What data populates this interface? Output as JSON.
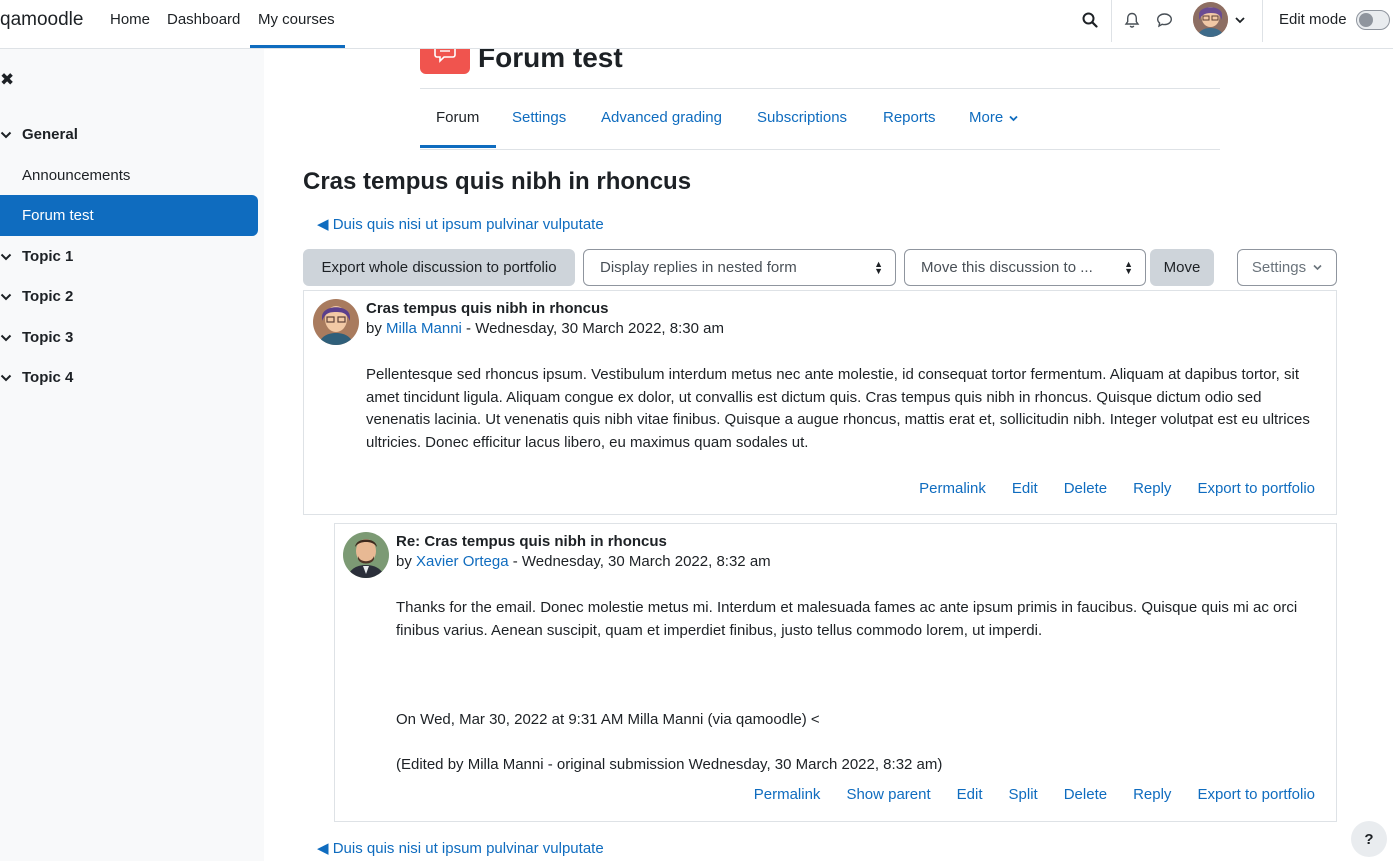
{
  "navbar": {
    "brand": "qamoodle",
    "links": [
      "Home",
      "Dashboard",
      "My courses"
    ],
    "active_link": "My courses",
    "edit_mode_label": "Edit mode",
    "edit_mode_on": false
  },
  "drawer": {
    "sections": [
      {
        "label": "General",
        "items": [
          "Announcements",
          "Forum test"
        ]
      },
      {
        "label": "Topic 1"
      },
      {
        "label": "Topic 2"
      },
      {
        "label": "Topic 3"
      },
      {
        "label": "Topic 4"
      }
    ],
    "active_item": "Forum test"
  },
  "forum": {
    "title": "Forum test",
    "tabs": [
      "Forum",
      "Settings",
      "Advanced grading",
      "Subscriptions",
      "Reports",
      "More"
    ],
    "active_tab": "Forum"
  },
  "discussion": {
    "title": "Cras tempus quis nibh in rhoncus",
    "prev_link": "◀ Duis quis nisi ut ipsum pulvinar vulputate",
    "export_button": "Export whole discussion to portfolio",
    "display_select": "Display replies in nested form",
    "move_select": "Move this discussion to ...",
    "move_button": "Move",
    "settings_button": "Settings"
  },
  "posts": [
    {
      "subject": "Cras tempus quis nibh in rhoncus",
      "by": "by",
      "author": "Milla Manni",
      "date": " - Wednesday, 30 March 2022, 8:30 am",
      "body": "Pellentesque sed rhoncus ipsum. Vestibulum interdum metus nec ante molestie, id consequat tortor fermentum. Aliquam at dapibus tortor, sit amet tincidunt ligula. Aliquam congue ex dolor, ut convallis est dictum quis. Cras tempus quis nibh in rhoncus. Quisque dictum odio sed venenatis lacinia. Ut venenatis quis nibh vitae finibus. Quisque a augue rhoncus, mattis erat et, sollicitudin nibh. Integer volutpat est eu ultrices ultricies. Donec efficitur lacus libero, eu maximus quam sodales ut.",
      "actions": [
        "Permalink",
        "Edit",
        "Delete",
        "Reply",
        "Export to portfolio"
      ]
    },
    {
      "subject": "Re: Cras tempus quis nibh in rhoncus",
      "by": "by",
      "author": "Xavier Ortega",
      "date": " - Wednesday, 30 March 2022, 8:32 am",
      "body": "Thanks for the email. Donec molestie metus mi. Interdum et malesuada fames ac ante ipsum primis in faucibus. Quisque quis mi ac orci finibus varius. Aenean suscipit, quam et imperdiet finibus, justo tellus commodo lorem, ut imperdi.",
      "quote_line": "On Wed, Mar 30, 2022 at 9:31 AM Milla Manni (via qamoodle) <",
      "edited_note": "(Edited by Milla Manni - original submission Wednesday, 30 March 2022, 8:32 am)",
      "actions": [
        "Permalink",
        "Show parent",
        "Edit",
        "Split",
        "Delete",
        "Reply",
        "Export to portfolio"
      ]
    }
  ],
  "help_label": "?",
  "colors": {
    "link": "#0f6cbf",
    "forum_icon": "#f0544e",
    "active_drawer": "#0f6cbf",
    "button_grey": "#ced4da"
  }
}
